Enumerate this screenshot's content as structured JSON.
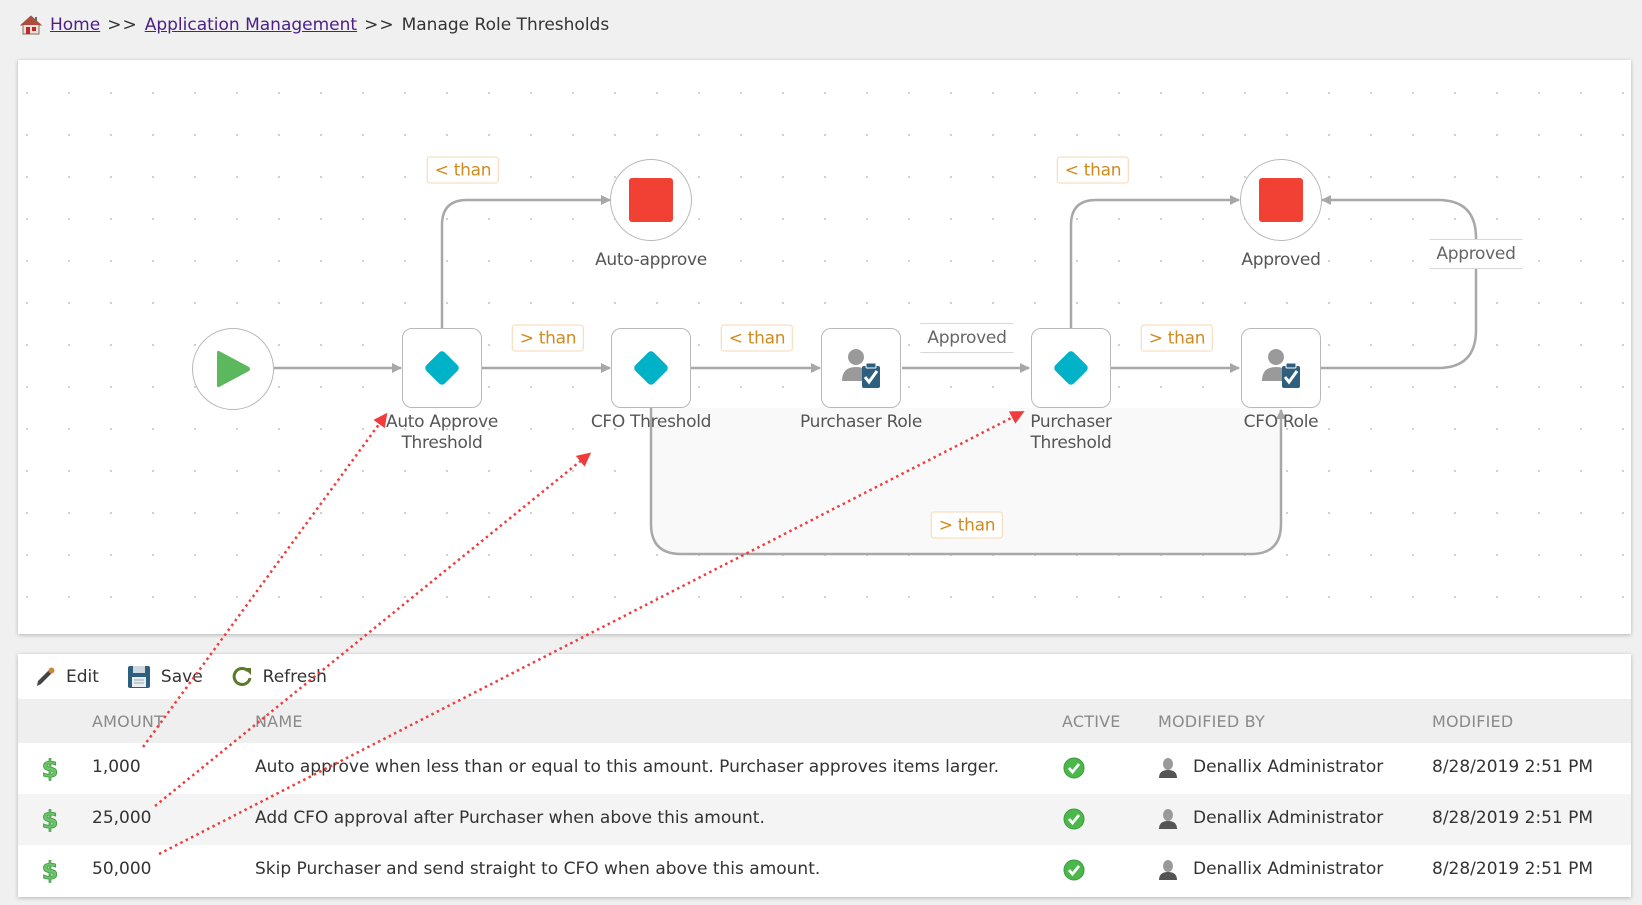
{
  "breadcrumb": {
    "home": "Home",
    "separator": ">>",
    "section": "Application Management",
    "current": "Manage Role Thresholds"
  },
  "diagram": {
    "nodes": {
      "start": {
        "label": "",
        "type": "start"
      },
      "auto_approve_threshold": {
        "label_line1": "Auto Approve",
        "label_line2": "Threshold",
        "type": "decision"
      },
      "auto_approve_end": {
        "label": "Auto-approve",
        "type": "end"
      },
      "cfo_threshold": {
        "label": "CFO Threshold",
        "type": "decision"
      },
      "purchaser_role": {
        "label": "Purchaser Role",
        "type": "role"
      },
      "purchaser_threshold": {
        "label_line1": "Purchaser",
        "label_line2": "Threshold",
        "type": "decision"
      },
      "approved_end": {
        "label": "Approved",
        "type": "end"
      },
      "cfo_role": {
        "label": "CFO Role",
        "type": "role"
      }
    },
    "edge_labels": {
      "auto_lt": "< than",
      "auto_gt": "> than",
      "cfo_lt": "< than",
      "purchaser_approved": "Approved",
      "purch_lt": "< than",
      "purch_gt": "> than",
      "cfo_role_approved": "Approved",
      "cfo_gt_bypass": "> than"
    },
    "colors": {
      "start": "#5cb85c",
      "decision": "#00b2c8",
      "end": "#f04134",
      "role_clipboard": "#2f5f7e",
      "edge": "#a8a8a8",
      "label_text": "#d08a1e",
      "annotation": "#f03c3c"
    }
  },
  "toolbar": {
    "edit": "Edit",
    "save": "Save",
    "refresh": "Refresh"
  },
  "grid": {
    "columns": {
      "amount": "AMOUNT",
      "name": "NAME",
      "active": "ACTIVE",
      "modified_by": "MODIFIED BY",
      "modified": "MODIFIED"
    },
    "rows": [
      {
        "amount": "1,000",
        "name": "Auto approve when less than or equal to this amount.  Purchaser approves items larger.",
        "active": true,
        "modified_by": "Denallix Administrator",
        "modified": "8/28/2019 2:51 PM"
      },
      {
        "amount": "25,000",
        "name": "Add CFO approval after Purchaser when above this amount.",
        "active": true,
        "modified_by": "Denallix Administrator",
        "modified": "8/28/2019 2:51 PM"
      },
      {
        "amount": "50,000",
        "name": "Skip Purchaser and send straight to CFO when above this amount.",
        "active": true,
        "modified_by": "Denallix Administrator",
        "modified": "8/28/2019 2:51 PM"
      }
    ]
  }
}
